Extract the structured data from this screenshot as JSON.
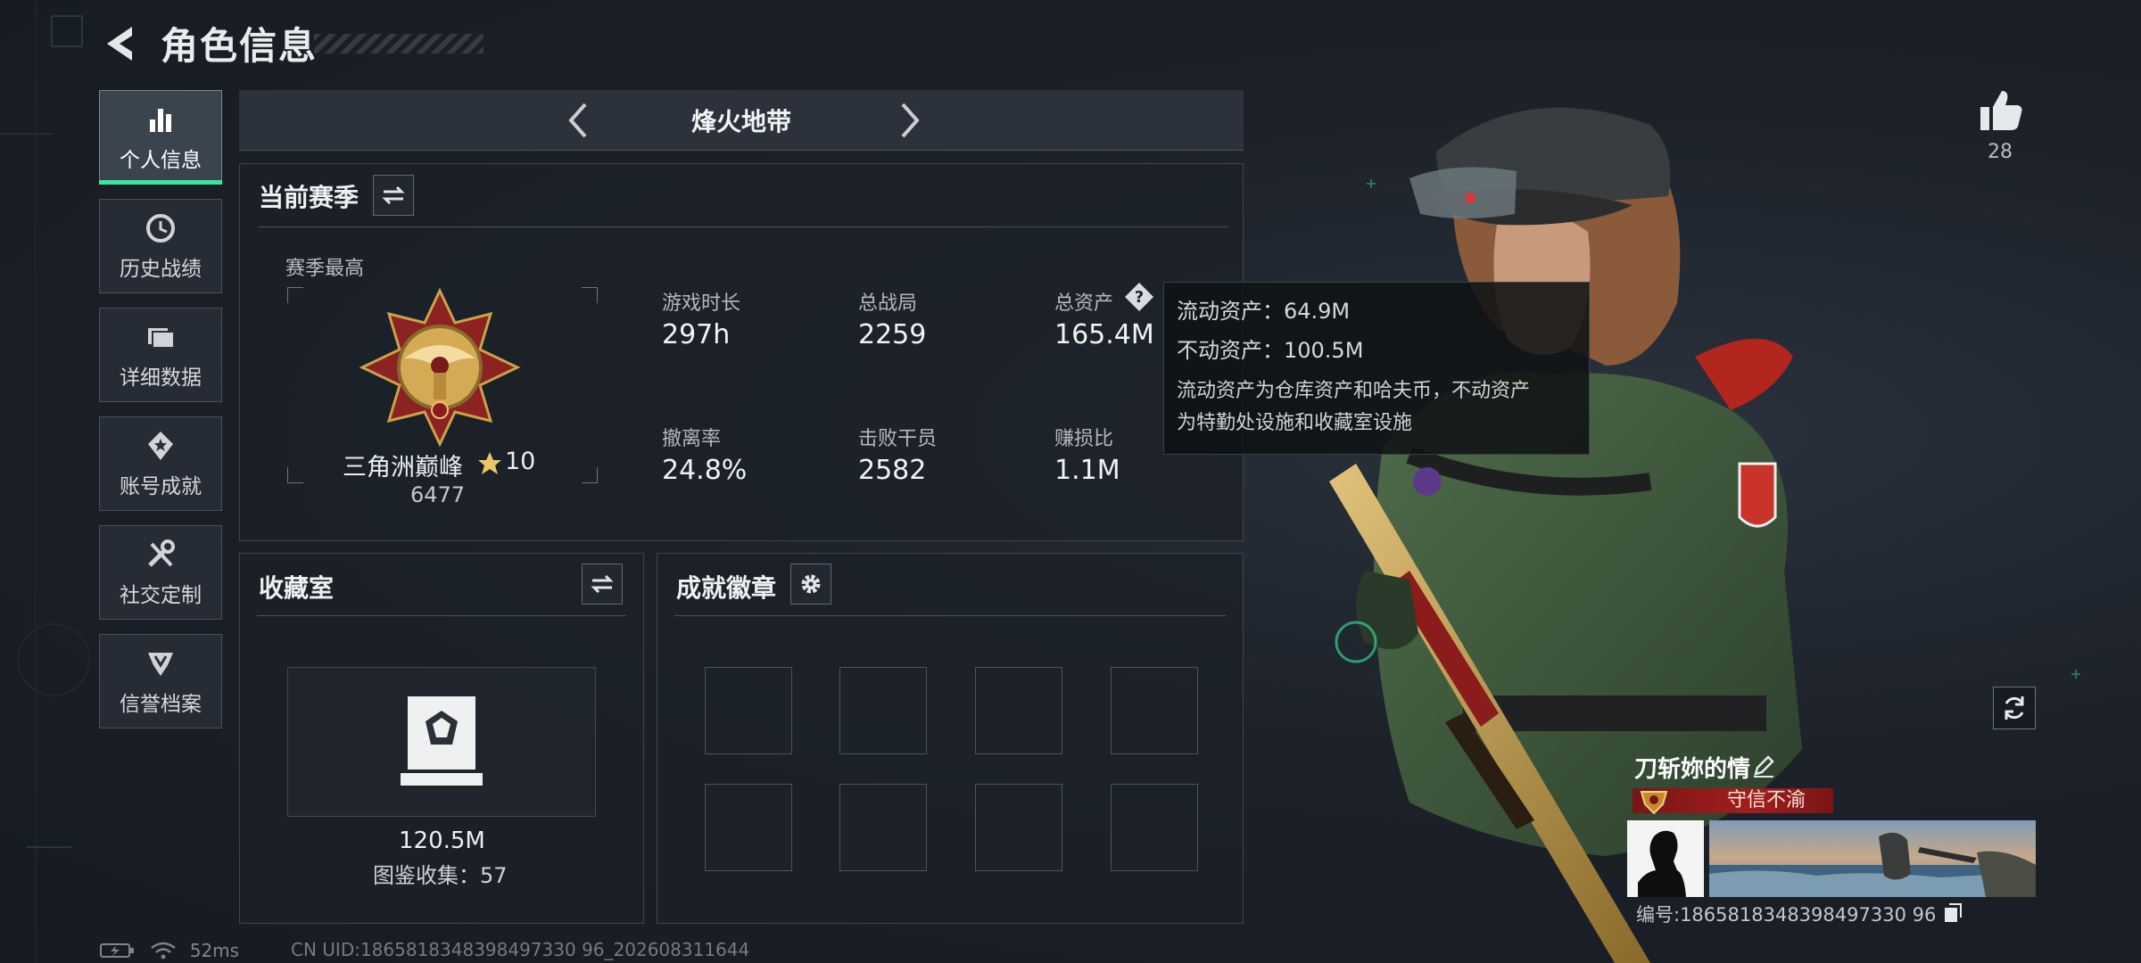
{
  "header": {
    "title": "角色信息"
  },
  "sidebar": {
    "items": [
      {
        "label": "个人信息",
        "icon": "bar-chart-icon",
        "active": true
      },
      {
        "label": "历史战绩",
        "icon": "history-clock-icon",
        "active": false
      },
      {
        "label": "详细数据",
        "icon": "folder-icon",
        "active": false
      },
      {
        "label": "账号成就",
        "icon": "achievement-icon",
        "active": false
      },
      {
        "label": "社交定制",
        "icon": "wrench-icon",
        "active": false
      },
      {
        "label": "信誉档案",
        "icon": "reputation-icon",
        "active": false
      }
    ]
  },
  "mode": {
    "title": "烽火地带"
  },
  "season": {
    "title": "当前赛季",
    "best_label": "赛季最高",
    "rank_name": "三角洲巅峰",
    "rank_stars": "10",
    "rank_score": "6477",
    "stats": [
      {
        "label": "游戏时长",
        "value": "297h"
      },
      {
        "label": "总战局",
        "value": "2259"
      },
      {
        "label": "总资产",
        "value": "165.4M"
      },
      {
        "label": "撤离率",
        "value": "24.8%"
      },
      {
        "label": "击败干员",
        "value": "2582"
      },
      {
        "label": "赚损比",
        "value": "1.1M"
      }
    ]
  },
  "tooltip": {
    "liquid": "流动资产：64.9M",
    "fixed": "不动资产：100.5M",
    "desc_line1": "流动资产为仓库资产和哈夫币，不动资产",
    "desc_line2": "为特勤处设施和收藏室设施"
  },
  "collection": {
    "title": "收藏室",
    "value": "120.5M",
    "count": "图鉴收集：57"
  },
  "badges": {
    "title": "成就徽章",
    "slots": 8
  },
  "profile": {
    "likes": "28",
    "name": "刀斩妳的情",
    "title_badge": "守信不渝",
    "id_text": "编号:1865818348398497330 96"
  },
  "footer": {
    "ping": "52ms",
    "uid": "CN UID:1865818348398497330 96_202608311644"
  },
  "colors": {
    "accent": "#39e6a2",
    "badge_red": "#a21e1e",
    "background": "#1b2028"
  }
}
